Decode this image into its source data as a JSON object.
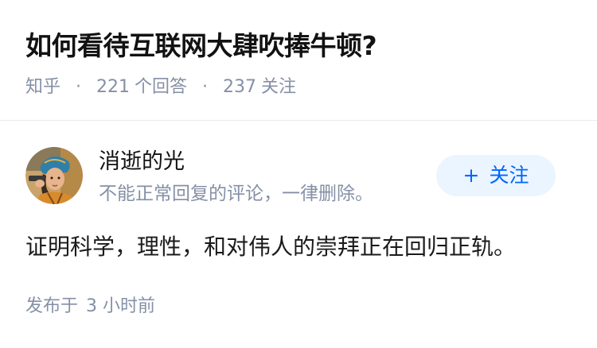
{
  "question": {
    "title": "如何看待互联网大肆吹捧牛顿?"
  },
  "meta": {
    "source": "知乎",
    "separator": "·",
    "answers_count": "221",
    "answers_label": "个回答",
    "followers_count": "237",
    "followers_label": "关注"
  },
  "author": {
    "name": "消逝的光",
    "bio": "不能正常回复的评论，一律删除。",
    "avatar_icon": "user-avatar-illustration"
  },
  "follow_button": {
    "plus": "+",
    "label": "关注"
  },
  "answer": {
    "content": "证明科学，理性，和对伟人的崇拜正在回归正轨。",
    "published_label": "发布于",
    "published_time": "3 小时前"
  },
  "colors": {
    "title": "#121212",
    "meta": "#8590a6",
    "follow_bg": "#ebf5ff",
    "follow_text": "#0066ff",
    "divider": "#ebebeb"
  }
}
